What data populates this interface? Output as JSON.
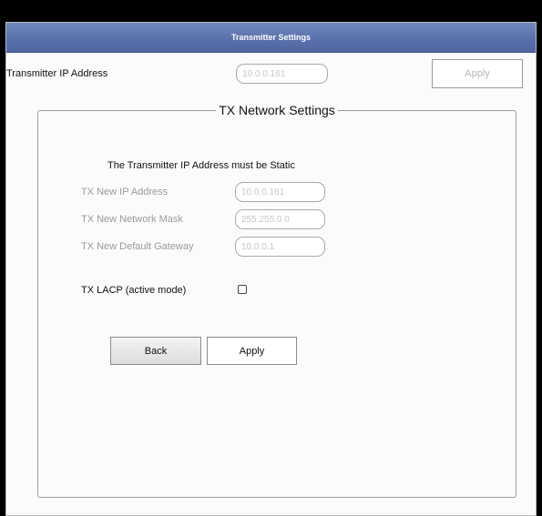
{
  "window": {
    "title": "Transmitter Settings"
  },
  "top": {
    "ip_label": "Transmitter IP Address",
    "ip_value": "10.0.0.161",
    "apply_label": "Apply"
  },
  "network": {
    "legend": "TX Network Settings",
    "notice": "The Transmitter IP Address must be Static",
    "new_ip_label": "TX New IP Address",
    "new_ip_value": "10.0.0.161",
    "mask_label": "TX New Network Mask",
    "mask_value": "255.255.0.0",
    "gateway_label": "TX New Default Gateway",
    "gateway_value": "10.0.0.1",
    "lacp_label": "TX LACP (active mode)",
    "lacp_checked": false,
    "back_label": "Back",
    "apply_label": "Apply"
  }
}
